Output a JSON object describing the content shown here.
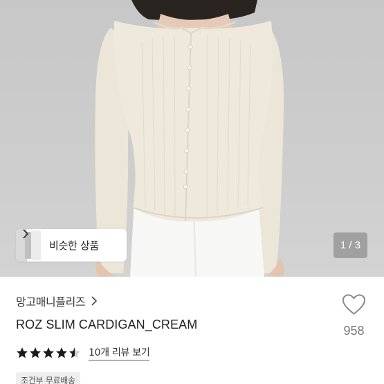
{
  "photo": {
    "alt_icon": "product-photo"
  },
  "similar": {
    "label": "비슷한 상품",
    "chevron_icon": "chevron-right-icon"
  },
  "pager": {
    "text": "1 / 3"
  },
  "product": {
    "brand": "망고매니플리즈",
    "brand_chevron_icon": "chevron-right-icon",
    "name": "ROZ SLIM CARDIGAN_CREAM",
    "rating": 4.5,
    "review_link": "10개 리뷰 보기",
    "shipping_badge": "조건부 무료배송"
  },
  "like": {
    "icon": "heart-outline-icon",
    "count": "958"
  },
  "colors": {
    "star": "#1a1a1a",
    "star_empty": "#cfcfcf",
    "cardigan": "#efe9dc",
    "background": "#cacaca"
  }
}
